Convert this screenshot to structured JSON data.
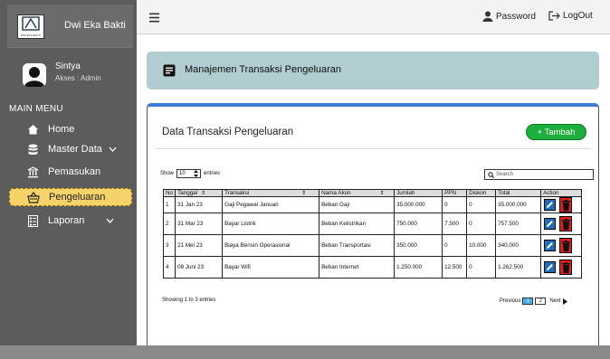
{
  "brand": {
    "name": "Dwi Eka Bakti",
    "logo_caption": "DWI EKA BAKTI"
  },
  "user": {
    "name": "Sintya",
    "role": "Akses : Admin"
  },
  "sidebar": {
    "section_title": "MAIN MENU",
    "items": [
      {
        "label": "Home",
        "icon": "home-icon"
      },
      {
        "label": "Master Data",
        "icon": "database-icon",
        "has_chevron": true
      },
      {
        "label": "Pemasukan",
        "icon": "bank-icon"
      },
      {
        "label": "Pengeluaran",
        "icon": "basket-icon",
        "active": true
      },
      {
        "label": "Laporan",
        "icon": "report-icon",
        "has_chevron": true
      }
    ]
  },
  "topbar": {
    "password_label": "Password",
    "logout_label": "LogOut"
  },
  "page_header": {
    "title": "Manajemen Transaksi Pengeluaran"
  },
  "card": {
    "title": "Data Transaksi Pengeluaran",
    "add_label": "+ Tambah",
    "show_label": "Show",
    "show_value": "10",
    "entries_label": "entries",
    "search_placeholder": "Search"
  },
  "table": {
    "headers": [
      "No",
      "Tanggal",
      "Transaksi",
      "Nama Akun",
      "Jumlah",
      "PPN",
      "Diskon",
      "Total",
      "Action"
    ],
    "rows": [
      [
        "1",
        "31 Jan 23",
        "Gaji Pegawai Januari",
        "Beban Gaji",
        "35.000.000",
        "0",
        "0",
        "35.000.000"
      ],
      [
        "2",
        "31 Mar 23",
        "Bayar Listrik",
        "Beban Kelistrikan",
        "750.000",
        "7.500",
        "0",
        "757.500"
      ],
      [
        "3",
        "21 Mei 23",
        "Biaya Bensin Operasional",
        "Beban Transportasi",
        "350.000",
        "0",
        "10.000",
        "340.000"
      ],
      [
        "4",
        "08 Juni 23",
        "Bayar Wifi",
        "Beban Internet",
        "1.250.000",
        "12.500",
        "0",
        "1.262.500"
      ]
    ]
  },
  "footer_info": "Showing 1 to 3 entries",
  "pager": {
    "previous": "Previous",
    "pages": [
      "1",
      "2"
    ],
    "current": "1",
    "next": "Next"
  },
  "colors": {
    "sidebar": "#5c5c5c",
    "active_item": "#f6d36a",
    "header_band": "#b1cdd1",
    "accent": "#3c7bd6",
    "add_button": "#1dae3b",
    "edit": "#1f6fb8",
    "delete": "#e31c1c"
  }
}
